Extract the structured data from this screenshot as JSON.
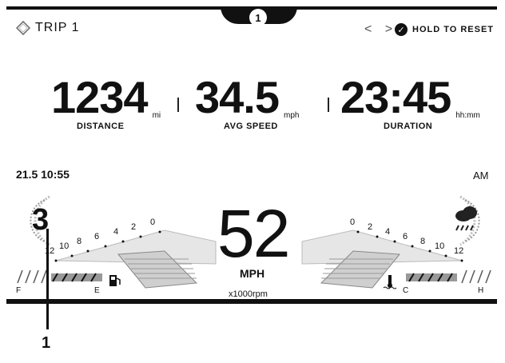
{
  "header": {
    "trip_label": "TRIP 1",
    "page_badge": "1",
    "nav_arrows": "< >",
    "reset_label": "HOLD TO RESET"
  },
  "stats": {
    "distance": {
      "value": "1234",
      "unit": "mi",
      "caption": "DISTANCE"
    },
    "avg_speed": {
      "value": "34.5",
      "unit": "mph",
      "caption": "AVG SPEED"
    },
    "duration": {
      "value": "23:45",
      "unit": "hh:mm",
      "caption": "DURATION"
    }
  },
  "status": {
    "odometer_time": "21.5 10:55",
    "ampm": "AM",
    "gear": "3"
  },
  "speedometer": {
    "speed": "52",
    "unit": "MPH",
    "rpm_label": "x1000rpm"
  },
  "tach_left_ticks": [
    "12",
    "10",
    "8",
    "6",
    "4",
    "2",
    "0"
  ],
  "tach_right_ticks": [
    "0",
    "2",
    "4",
    "6",
    "8",
    "10",
    "12"
  ],
  "fuel_gauge": {
    "low": "F",
    "high": "E"
  },
  "temp_gauge": {
    "low": "C",
    "high": "H"
  },
  "callout": {
    "number": "1"
  },
  "icons": [
    "trip-icon",
    "checkmark-icon",
    "fuel-pump-icon",
    "coolant-temp-icon",
    "rain-cloud-icon"
  ],
  "colors": {
    "accent": "#111111",
    "gauge_fill": "#a9a9a9"
  }
}
